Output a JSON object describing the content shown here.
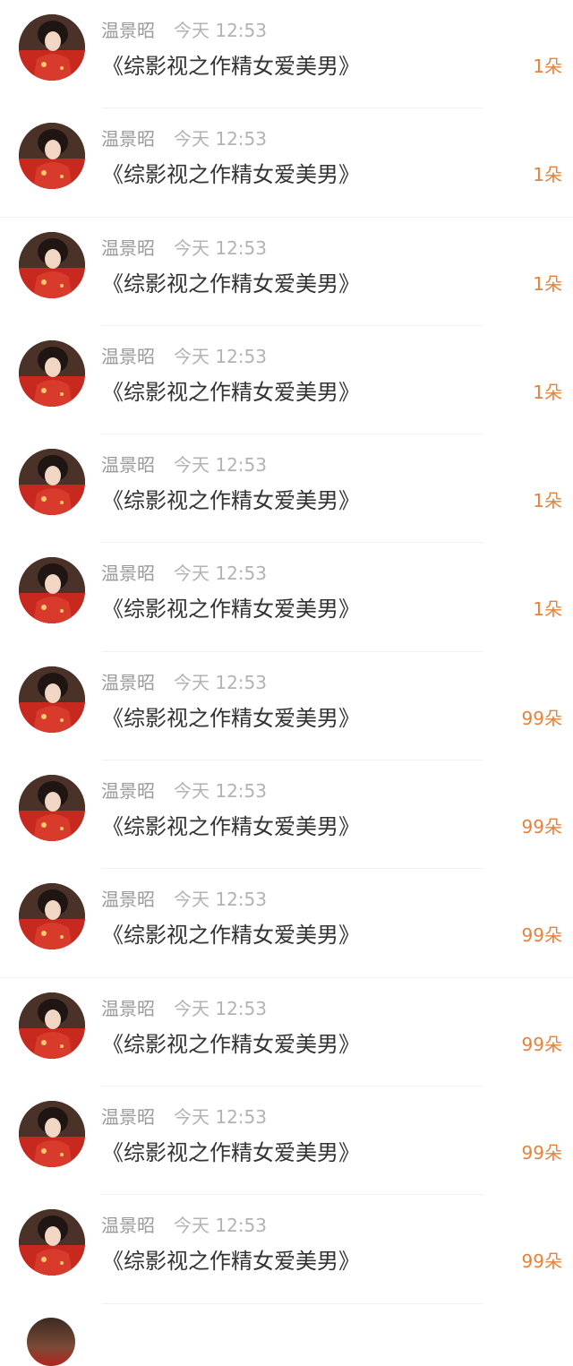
{
  "items": [
    {
      "username": "温景昭",
      "time": "今天 12:53",
      "title": "《综影视之作精女爱美男》",
      "count": "1朵"
    },
    {
      "username": "温景昭",
      "time": "今天 12:53",
      "title": "《综影视之作精女爱美男》",
      "count": "1朵"
    },
    {
      "username": "温景昭",
      "time": "今天 12:53",
      "title": "《综影视之作精女爱美男》",
      "count": "1朵"
    },
    {
      "username": "温景昭",
      "time": "今天 12:53",
      "title": "《综影视之作精女爱美男》",
      "count": "1朵"
    },
    {
      "username": "温景昭",
      "time": "今天 12:53",
      "title": "《综影视之作精女爱美男》",
      "count": "1朵"
    },
    {
      "username": "温景昭",
      "time": "今天 12:53",
      "title": "《综影视之作精女爱美男》",
      "count": "1朵"
    },
    {
      "username": "温景昭",
      "time": "今天 12:53",
      "title": "《综影视之作精女爱美男》",
      "count": "99朵"
    },
    {
      "username": "温景昭",
      "time": "今天 12:53",
      "title": "《综影视之作精女爱美男》",
      "count": "99朵"
    },
    {
      "username": "温景昭",
      "time": "今天 12:53",
      "title": "《综影视之作精女爱美男》",
      "count": "99朵"
    },
    {
      "username": "温景昭",
      "time": "今天 12:53",
      "title": "《综影视之作精女爱美男》",
      "count": "99朵"
    },
    {
      "username": "温景昭",
      "time": "今天 12:53",
      "title": "《综影视之作精女爱美男》",
      "count": "99朵"
    },
    {
      "username": "温景昭",
      "time": "今天 12:53",
      "title": "《综影视之作精女爱美男》",
      "count": "99朵"
    }
  ],
  "colors": {
    "count_accent": "#e7823a",
    "username": "#9a9a9a",
    "time": "#b3b3b3",
    "title": "#333333"
  },
  "icons": {
    "avatar": "user-avatar-portrait"
  }
}
